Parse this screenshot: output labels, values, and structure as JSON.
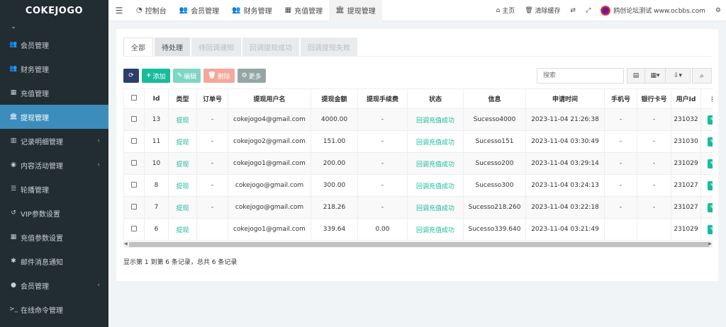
{
  "app": {
    "brand": "COKEJOGO"
  },
  "sidebar": {
    "items": [
      {
        "label": "",
        "icon": "partial-icon"
      },
      {
        "label": "会员管理",
        "icon": "users-icon",
        "chev": ""
      },
      {
        "label": "财务管理",
        "icon": "users-icon",
        "chev": ""
      },
      {
        "label": "充值管理",
        "icon": "grid-icon",
        "chev": ""
      },
      {
        "label": "提现管理",
        "icon": "bank-icon",
        "chev": "",
        "active": true
      },
      {
        "label": "记录明细管理",
        "icon": "bar-chart-icon",
        "chev": "‹"
      },
      {
        "label": "内容活动管理",
        "icon": "globe-icon",
        "chev": "‹"
      },
      {
        "label": "轮播管理",
        "icon": "list-icon",
        "chev": ""
      },
      {
        "label": "VIP参数设置",
        "icon": "history-icon",
        "chev": ""
      },
      {
        "label": "充值参数设置",
        "icon": "grid-icon",
        "chev": ""
      },
      {
        "label": "邮件消息通知",
        "icon": "gear-icon",
        "chev": ""
      },
      {
        "label": "会员管理",
        "icon": "user-circle-icon",
        "chev": "‹"
      },
      {
        "label": "在线命令管理",
        "icon": "terminal-icon",
        "chev": ""
      }
    ]
  },
  "topnav": {
    "tabs": [
      {
        "label": "控制台",
        "icon": "dashboard-icon"
      },
      {
        "label": "会员管理",
        "icon": "users-icon"
      },
      {
        "label": "财务管理",
        "icon": "users-icon"
      },
      {
        "label": "充值管理",
        "icon": "grid-icon"
      },
      {
        "label": "提现管理",
        "icon": "bank-icon",
        "active": true
      }
    ],
    "home": "主页",
    "clear_cache": "清除缓存",
    "username": "鸥创论坛测试 www.ocbbs.com"
  },
  "status_tabs": [
    "全部",
    "待处理",
    "待回调通知",
    "回调提现成功",
    "回调提现失败"
  ],
  "toolbar": {
    "add": "添加",
    "edit": "编辑",
    "delete": "删除",
    "more": "更多"
  },
  "search": {
    "placeholder": "搜索"
  },
  "table": {
    "columns": [
      "Id",
      "类型",
      "订单号",
      "提现用户名",
      "提现金额",
      "提现手续费",
      "状态",
      "信息",
      "申请时间",
      "手机号",
      "银行卡号",
      "用户Id",
      "操作"
    ],
    "rows": [
      [
        "13",
        "提现",
        "-",
        "cokejogo4@gmail.com",
        "4000.00",
        "-",
        "回调充值成功",
        "Sucesso4000",
        "2023-11-04 21:26:38",
        "-",
        "-",
        "231032"
      ],
      [
        "11",
        "提现",
        "-",
        "cokejogo2@gmail.com",
        "151.00",
        "-",
        "回调充值成功",
        "Sucesso151",
        "2023-11-04 03:30:49",
        "-",
        "-",
        "231030"
      ],
      [
        "10",
        "提现",
        "-",
        "cokejogo1@gmail.com",
        "200.00",
        "-",
        "回调充值成功",
        "Sucesso200",
        "2023-11-04 03:29:14",
        "-",
        "-",
        "231029"
      ],
      [
        "8",
        "提现",
        "-",
        "cokejogo@gmail.com",
        "300.00",
        "-",
        "回调充值成功",
        "Sucesso300",
        "2023-11-04 03:24:13",
        "-",
        "-",
        "231027"
      ],
      [
        "7",
        "提现",
        "-",
        "cokejogo@gmail.com",
        "218.26",
        "-",
        "回调充值成功",
        "Sucesso218.260",
        "2023-11-04 03:22:18",
        "-",
        "-",
        "231027"
      ],
      [
        "6",
        "提现",
        "",
        "cokejogo1@gmail.com",
        "339.64",
        "0.00",
        "回调充值成功",
        "Sucesso339.640",
        "2023-11-04 03:21:49",
        "",
        "",
        "231029"
      ]
    ]
  },
  "pagination": {
    "info": "显示第 1 到第 6 条记录，总共 6 条记录"
  },
  "colors": {
    "sidebar_bg": "#222d32",
    "active": "#3c8dbc",
    "success": "#18bc9c",
    "danger": "#e74c3c"
  }
}
